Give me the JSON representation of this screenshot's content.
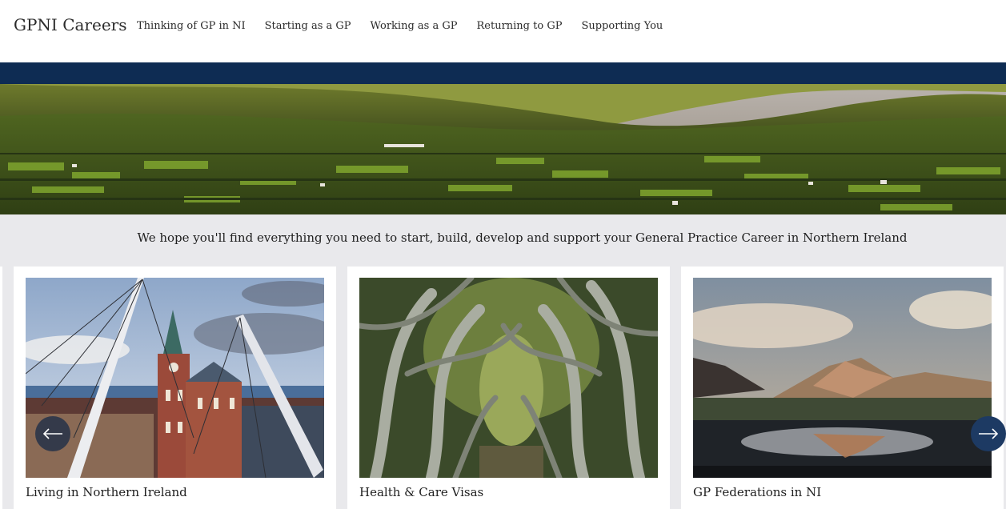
{
  "header": {
    "brand": "GPNI Careers",
    "nav": [
      {
        "label": "Thinking of GP in NI"
      },
      {
        "label": "Starting as a GP"
      },
      {
        "label": "Working as a GP"
      },
      {
        "label": "Returning to GP"
      },
      {
        "label": "Supporting You"
      }
    ]
  },
  "colors": {
    "navy": "#0e2c53",
    "page_bg": "#e9e9ec",
    "arrow_bg": "#1d3a63"
  },
  "intro": {
    "text": "We hope you'll find everything you need to start, build, develop and support your General Practice Career in Northern Ireland"
  },
  "carousel": {
    "cards": [
      {
        "title": "Living in Northern Ireland",
        "image": "derry-peace-bridge-guildhall-photo"
      },
      {
        "title": "Health & Care Visas",
        "image": "dark-hedges-trees-photo"
      },
      {
        "title": "GP Federations in NI",
        "image": "mourne-mountain-reflection-photo"
      }
    ],
    "prev_icon": "arrow-left-icon",
    "next_icon": "arrow-right-icon"
  }
}
